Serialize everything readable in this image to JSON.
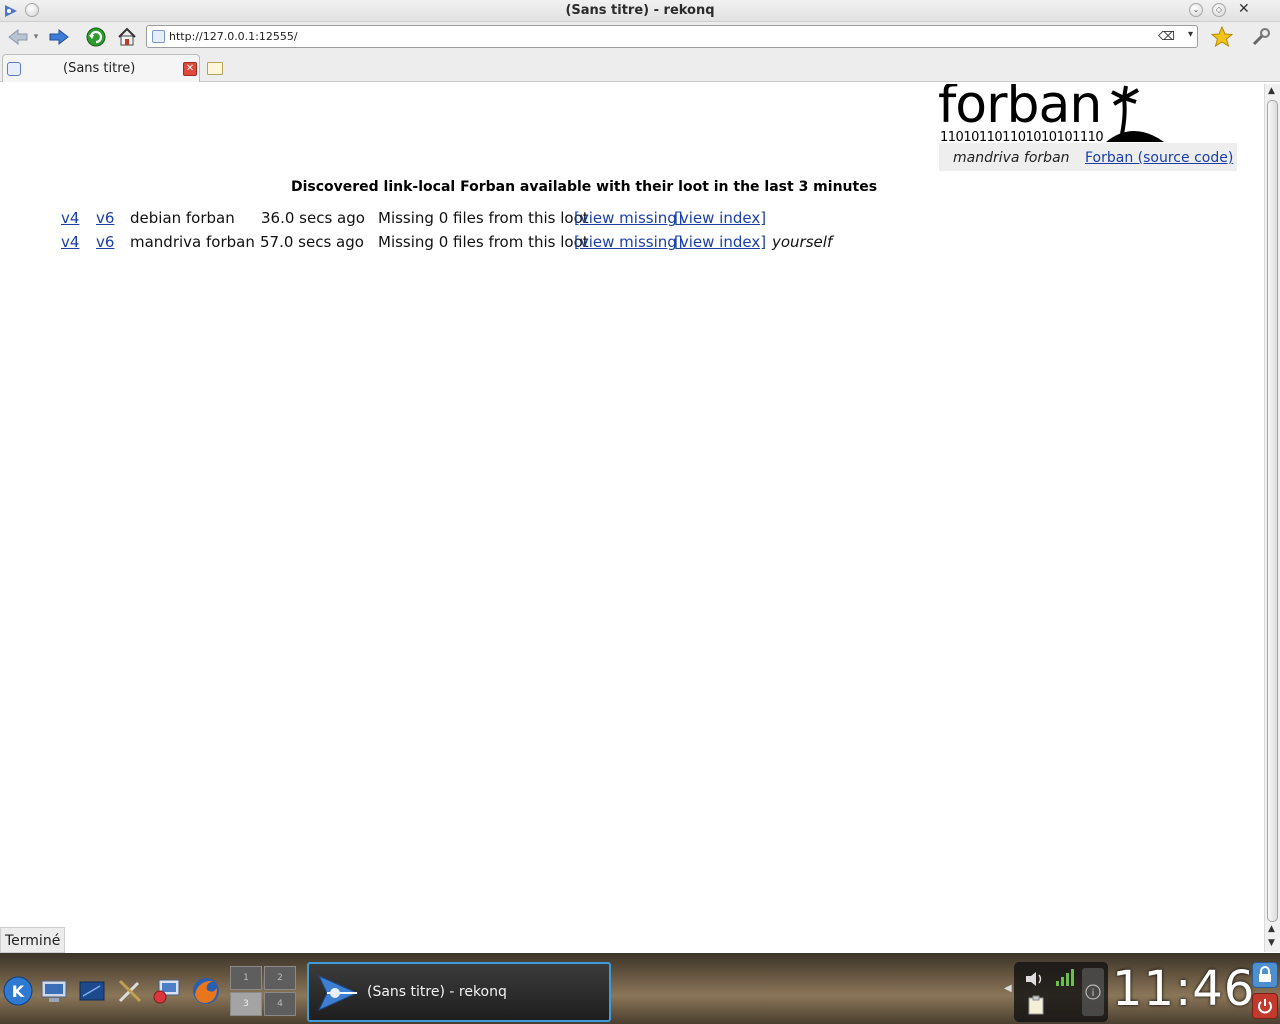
{
  "window": {
    "title": "(Sans titre) - rekonq"
  },
  "toolbar": {
    "url": "http://127.0.0.1:12555/"
  },
  "tabs": [
    {
      "label": "(Sans titre)"
    }
  ],
  "page": {
    "logo_word": "forban",
    "logo_bits": "110101101101010101110",
    "hostname": "mandriva forban",
    "source_link": "Forban (source code)",
    "heading": "Discovered link-local Forban available with their loot in the last 3 minutes",
    "peers": [
      {
        "v4": "v4",
        "v6": "v6",
        "name": "debian forban",
        "age": "36.0 secs ago",
        "missing": "Missing 0 files from this loot",
        "view_missing": "[view missing]",
        "view_index": "[view index]",
        "note": ""
      },
      {
        "v4": "v4",
        "v6": "v6",
        "name": "mandriva forban",
        "age": "57.0 secs ago",
        "missing": "Missing 0 files from this loot",
        "view_missing": "[view missing]",
        "view_index": "[view index]",
        "note": "yourself"
      }
    ]
  },
  "status": {
    "text": "Terminé"
  },
  "taskbar": {
    "pager_desktops": [
      "1",
      "2",
      "3",
      "4"
    ],
    "task_label": "(Sans titre) - rekonq",
    "clock": "11:46"
  },
  "colors": {
    "link": "#1a3fa8",
    "task_border": "#3f9ad8",
    "close_tab": "#e04a3c"
  }
}
